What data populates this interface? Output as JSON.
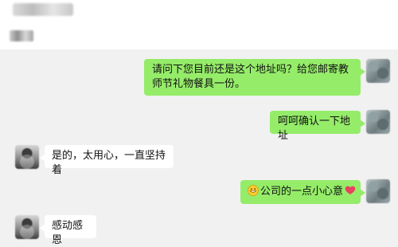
{
  "colors": {
    "page_background": "#ffffff",
    "chat_background": "#f1f1f1",
    "sent_bubble": "#95ec69",
    "received_bubble": "#ffffff",
    "text": "#111111",
    "heart": "#e9415f",
    "emoji": "#ffcc33"
  },
  "messages": [
    {
      "direction": "sent",
      "text": "请问下您目前还是这个地址吗？给您邮寄教师节礼物餐具一份。",
      "avatar": "blurred-avatar"
    },
    {
      "direction": "sent",
      "text": "呵呵确认一下地址",
      "avatar": "blurred-avatar"
    },
    {
      "direction": "received",
      "text": "是的，太用心，一直坚持着",
      "avatar": "blurred-avatar"
    },
    {
      "direction": "sent",
      "text": "公司的一点小心意",
      "prefix_icon": "grinning-face-icon",
      "suffix_icon": "heart-icon",
      "avatar": "blurred-avatar"
    },
    {
      "direction": "received",
      "text": "感动感恩",
      "avatar": "blurred-avatar"
    }
  ]
}
